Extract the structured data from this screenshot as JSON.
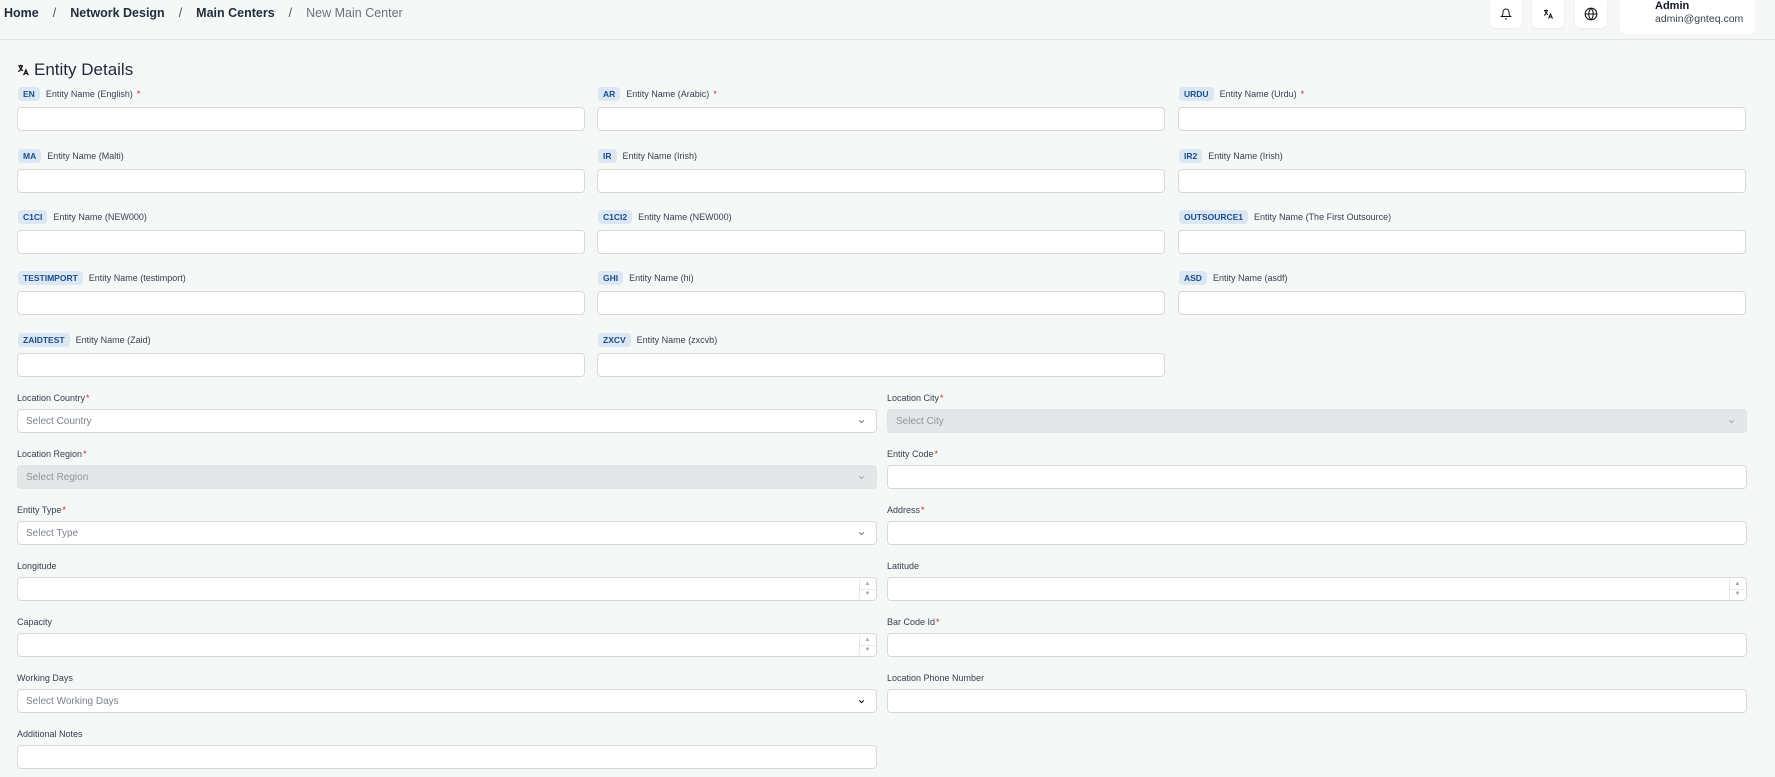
{
  "breadcrumb": {
    "items": [
      "Home",
      "Network Design",
      "Main Centers"
    ],
    "current": "New Main Center",
    "separator": "/"
  },
  "header": {
    "user_name": "Admin",
    "user_email": "admin@gnteq.com"
  },
  "section": {
    "title": "Entity Details"
  },
  "entity_names": [
    {
      "code": "EN",
      "label": "Entity Name (English)",
      "required": "*"
    },
    {
      "code": "AR",
      "label": "Entity Name (Arabic)",
      "required": "*"
    },
    {
      "code": "URDU",
      "label": "Entity Name (Urdu)",
      "required": "*"
    },
    {
      "code": "MA",
      "label": "Entity Name (Malti)"
    },
    {
      "code": "IR",
      "label": "Entity Name (Irish)"
    },
    {
      "code": "IR2",
      "label": "Entity Name (Irish)"
    },
    {
      "code": "C1CI",
      "label": "Entity Name (NEW000)"
    },
    {
      "code": "C1CI2",
      "label": "Entity Name (NEW000)"
    },
    {
      "code": "OUTSOURCE1",
      "label": "Entity Name (The First Outsource)"
    },
    {
      "code": "TESTIMPORT",
      "label": "Entity Name (testimport)"
    },
    {
      "code": "GHI",
      "label": "Entity Name (hi)"
    },
    {
      "code": "ASD",
      "label": "Entity Name (asdf)"
    },
    {
      "code": "ZAIDTEST",
      "label": "Entity Name (Zaid)"
    },
    {
      "code": "ZXCV",
      "label": "Entity Name (zxcvb)"
    }
  ],
  "form": {
    "location_country": {
      "label": "Location Country",
      "required": "*",
      "placeholder": "Select Country"
    },
    "location_city": {
      "label": "Location City",
      "required": "*",
      "placeholder": "Select City"
    },
    "location_region": {
      "label": "Location Region",
      "required": "*",
      "placeholder": "Select Region"
    },
    "entity_code": {
      "label": "Entity Code",
      "required": "*"
    },
    "entity_type": {
      "label": "Entity Type",
      "required": "*",
      "placeholder": "Select Type"
    },
    "address": {
      "label": "Address",
      "required": "*"
    },
    "longitude": {
      "label": "Longitude"
    },
    "latitude": {
      "label": "Latitude"
    },
    "capacity": {
      "label": "Capacity"
    },
    "bar_code_id": {
      "label": "Bar Code Id",
      "required": "*"
    },
    "working_days": {
      "label": "Working Days",
      "placeholder": "Select Working Days"
    },
    "location_phone": {
      "label": "Location Phone Number"
    },
    "additional_notes": {
      "label": "Additional Notes"
    }
  },
  "icons": {
    "notifications": "bell-icon",
    "translate": "translate-icon",
    "language": "globe-icon"
  }
}
